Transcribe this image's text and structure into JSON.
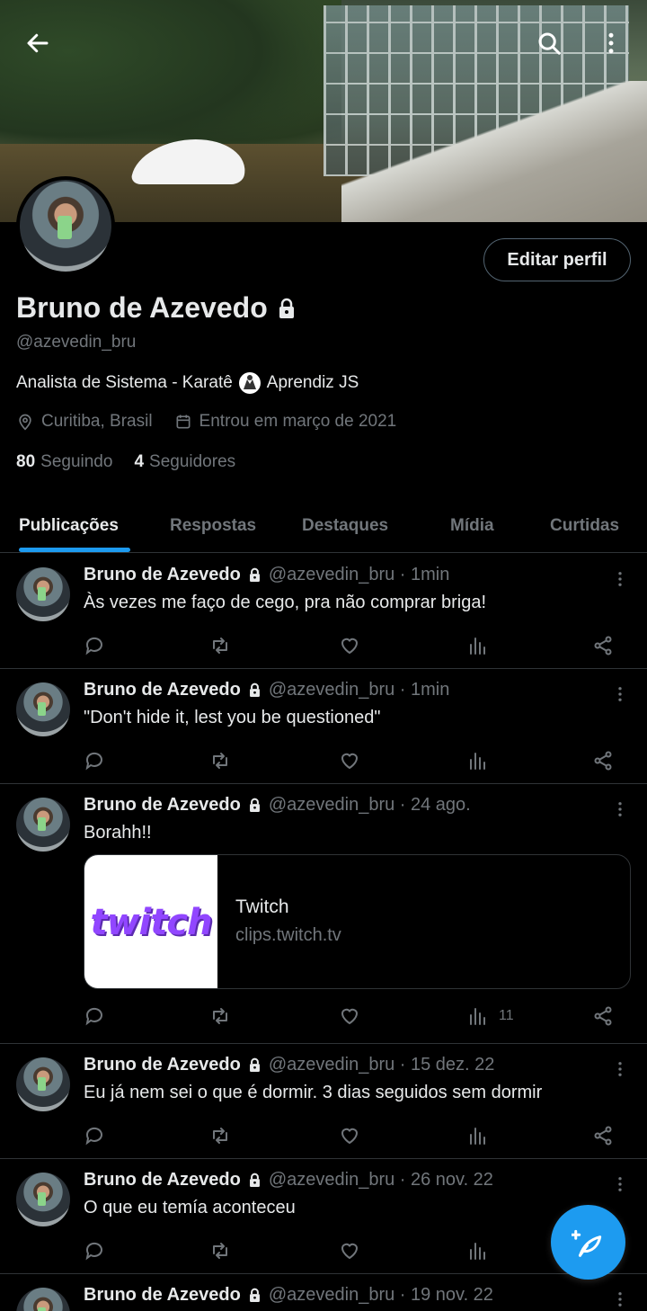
{
  "profile": {
    "name": "Bruno de Azevedo",
    "handle": "@azevedin_bru",
    "bio_part1": "Analista de Sistema  - Karatê",
    "bio_part2": "Aprendiz JS",
    "location": "Curitiba, Brasil",
    "joined": "Entrou em março de 2021",
    "following_count": "80",
    "following_label": "Seguindo",
    "followers_count": "4",
    "followers_label": "Seguidores",
    "edit_label": "Editar perfil"
  },
  "tabs": [
    {
      "label": "Publicações"
    },
    {
      "label": "Respostas"
    },
    {
      "label": "Destaques"
    },
    {
      "label": "Mídia"
    },
    {
      "label": "Curtidas"
    }
  ],
  "tweets": [
    {
      "name": "Bruno de Azevedo",
      "meta": "@azevedin_bru · 1min",
      "text": "Às vezes me faço de cego, pra não comprar briga!",
      "views": ""
    },
    {
      "name": "Bruno de Azevedo",
      "meta": "@azevedin_bru · 1min",
      "text": "\"Don't hide it, lest you be questioned\"",
      "views": ""
    },
    {
      "name": "Bruno de Azevedo",
      "meta": "@azevedin_bru · 24 ago.",
      "text": "Borahh!!",
      "views": "11",
      "card": {
        "logo": "twitch",
        "title": "Twitch",
        "url": "clips.twitch.tv"
      }
    },
    {
      "name": "Bruno de Azevedo",
      "meta": "@azevedin_bru · 15 dez. 22",
      "text": "Eu já nem sei o que é dormir. 3 dias seguidos sem dormir",
      "views": ""
    },
    {
      "name": "Bruno de Azevedo",
      "meta": "@azevedin_bru · 26 nov. 22",
      "text": "O que eu temía aconteceu",
      "views": ""
    },
    {
      "name": "Bruno de Azevedo",
      "meta": "@azevedin_bru · 19 nov. 22",
      "text": "",
      "views": ""
    }
  ],
  "colors": {
    "accent": "#1d9bf0",
    "muted": "#71767b",
    "twitch": "#9146ff"
  }
}
